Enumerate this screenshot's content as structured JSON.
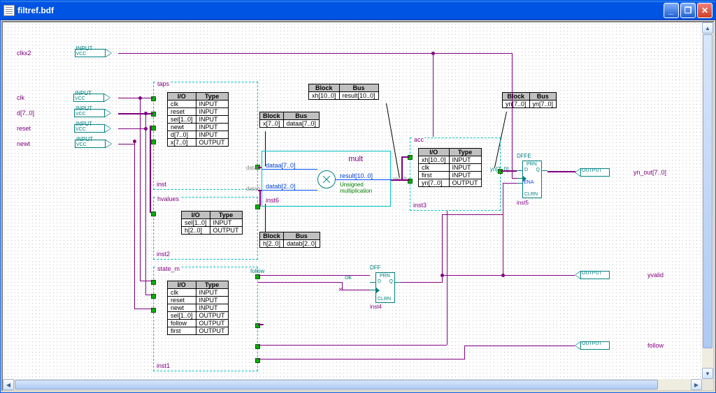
{
  "window": {
    "title": "filtref.bdf"
  },
  "inputs": {
    "clkx2": "clkx2",
    "clk": "clk",
    "d": "d[7..0]",
    "reset": "reset",
    "newt": "newt",
    "pin_type": "INPUT",
    "pin_vcc": "VCC"
  },
  "outputs": {
    "yn_out": "yn_out[7..0]",
    "yvalid": "yvalid",
    "follow": "follow",
    "pin_type": "OUTPUT"
  },
  "blocks": {
    "taps": {
      "title": "taps",
      "inst": "inst",
      "io": [
        {
          "n": "clk",
          "t": "INPUT"
        },
        {
          "n": "reset",
          "t": "INPUT"
        },
        {
          "n": "sel[1..0]",
          "t": "INPUT"
        },
        {
          "n": "newt",
          "t": "INPUT"
        },
        {
          "n": "d[7..0]",
          "t": "INPUT"
        },
        {
          "n": "x[7..0]",
          "t": "OUTPUT"
        }
      ]
    },
    "hvalues": {
      "title": "hvalues",
      "inst": "inst2",
      "io": [
        {
          "n": "sel[1..0]",
          "t": "INPUT"
        },
        {
          "n": "h[2..0]",
          "t": "OUTPUT"
        }
      ]
    },
    "state_m": {
      "title": "state_m",
      "inst": "inst1",
      "io": [
        {
          "n": "clk",
          "t": "INPUT"
        },
        {
          "n": "reset",
          "t": "INPUT"
        },
        {
          "n": "newt",
          "t": "INPUT"
        },
        {
          "n": "sel[1..0]",
          "t": "OUTPUT"
        },
        {
          "n": "follow",
          "t": "OUTPUT"
        },
        {
          "n": "first",
          "t": "OUTPUT"
        }
      ]
    },
    "acc": {
      "title": "acc",
      "inst": "inst3",
      "io": [
        {
          "n": "xh[10..0]",
          "t": "INPUT"
        },
        {
          "n": "clk",
          "t": "INPUT"
        },
        {
          "n": "first",
          "t": "INPUT"
        },
        {
          "n": "yn[7..0]",
          "t": "OUTPUT"
        }
      ]
    }
  },
  "bus_tables": {
    "x": {
      "h": [
        "Block",
        "Bus"
      ],
      "r": [
        "x[7..0]",
        "dataa[7..0]"
      ]
    },
    "h": {
      "h": [
        "Block",
        "Bus"
      ],
      "r": [
        "h[2..0]",
        "datab[2..0]"
      ]
    },
    "xh": {
      "h": [
        "Block",
        "Bus"
      ],
      "r": [
        "xh[10..0]",
        "result[10..0]"
      ]
    },
    "yn": {
      "h": [
        "Block",
        "Bus"
      ],
      "r": [
        "yn[7..0]",
        "yn[7..0]"
      ]
    }
  },
  "mult": {
    "title": "mult",
    "inst": "inst6",
    "dataa": "dataa[7..0]",
    "datab": "datab[2..0]",
    "result": "result[10..0]",
    "note": "Unsigned\nmultiplication",
    "pins": {
      "pa": "dataa",
      "pb": "datab",
      "pr": "result"
    }
  },
  "dff1": {
    "label": "DFF",
    "inst": "inst4"
  },
  "dff2": {
    "label": "DFFE",
    "inst": "inst5"
  },
  "misc": {
    "follow": "follow",
    "clk": "clk",
    "yn": "yn[7..0]"
  },
  "io_header": {
    "c1": "I/O",
    "c2": "Type"
  }
}
